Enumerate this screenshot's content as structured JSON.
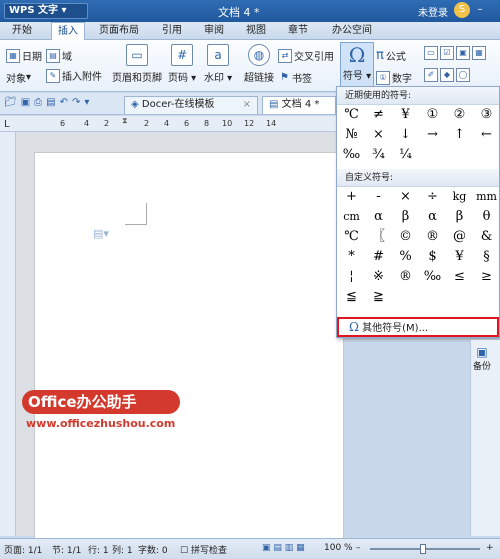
{
  "titlebar": {
    "app": "WPS 文字",
    "doc": "文档 4 *",
    "login": "未登录"
  },
  "menus": [
    "开始",
    "插入",
    "页面布局",
    "引用",
    "审阅",
    "视图",
    "章节",
    "办公空间"
  ],
  "ribbon": {
    "date": "日期",
    "field": "域",
    "object": "对象",
    "attach": "插入附件",
    "header_footer": "页眉和页脚",
    "page_num": "页码",
    "watermark": "水印",
    "hyperlink": "超链接",
    "crossref": "交叉引用",
    "bookmark": "书签",
    "symbol": "符号",
    "formula": "公式",
    "number": "数字"
  },
  "tabs": {
    "docer": "Docer-在线模板",
    "doc": "文档 4 *"
  },
  "ruler": [
    "6",
    "4",
    "2",
    "2",
    "4",
    "6",
    "8",
    "10",
    "12",
    "14"
  ],
  "panel": {
    "recent_title": "近期使用的符号:",
    "recent": [
      "℃",
      "≠",
      "¥",
      "①",
      "②",
      "③",
      "№",
      "×",
      "↓",
      "→",
      "↑",
      "←",
      "‰",
      "¾",
      "¼"
    ],
    "custom_title": "自定义符号:",
    "custom": [
      "+",
      "-",
      "×",
      "÷",
      "kg",
      "mm",
      "cm",
      "α",
      "β",
      "α",
      "β",
      "θ",
      "℃",
      "〖",
      "©",
      "®",
      "@",
      "&",
      "*",
      "#",
      "%",
      "$",
      "¥",
      "§",
      "¦",
      "※",
      "®",
      "‰",
      "≤",
      "≥",
      "≦",
      "≧"
    ],
    "more": "其他符号(M)..."
  },
  "watermark": {
    "brand": "Office办公助手",
    "url": "www.officezhushou.com"
  },
  "backup": "备份",
  "status": {
    "page": "页面: 1/1",
    "section": "节: 1/1",
    "row": "行: 1",
    "col": "列: 1",
    "words": "字数: 0",
    "spell": "拼写检查",
    "zoom": "100 %"
  }
}
